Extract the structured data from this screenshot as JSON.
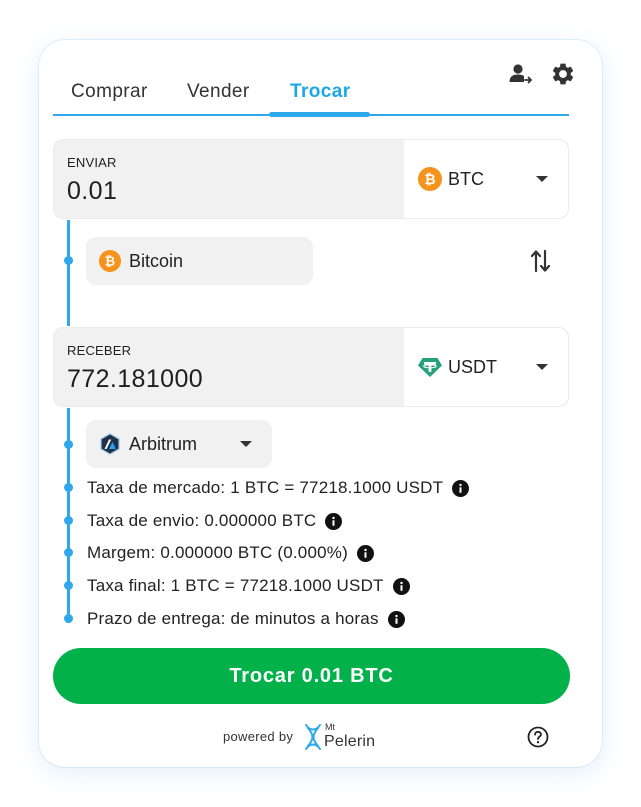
{
  "header": {
    "account_icon": "person-arrow-icon",
    "settings_icon": "gear-icon"
  },
  "tabs": [
    {
      "label": "Comprar",
      "active": false
    },
    {
      "label": "Vender",
      "active": false
    },
    {
      "label": "Trocar",
      "active": true
    }
  ],
  "send": {
    "label": "ENVIAR",
    "amount": "0.01",
    "currency": "BTC",
    "currency_icon": "bitcoin-icon",
    "network": "Bitcoin",
    "network_icon": "bitcoin-icon"
  },
  "receive": {
    "label": "RECEBER",
    "amount": "772.181000",
    "currency": "USDT",
    "currency_icon": "tether-icon",
    "network": "Arbitrum",
    "network_icon": "arbitrum-icon"
  },
  "rates": [
    {
      "text": "Taxa de mercado: 1 BTC = 77218.1000 USDT"
    },
    {
      "text": "Taxa de envio: 0.000000 BTC"
    },
    {
      "text": "Margem: 0.000000 BTC (0.000%)"
    },
    {
      "text": "Taxa final: 1 BTC = 77218.1000 USDT"
    },
    {
      "text": "Prazo de entrega: de minutos a horas"
    }
  ],
  "action_button": "Trocar 0.01 BTC",
  "footer": {
    "powered_by": "powered by",
    "brand_small": "Mt",
    "brand": "Pelerin",
    "help_icon": "question-circle-icon"
  },
  "colors": {
    "accent": "#2ea8ea",
    "button": "#03b14b",
    "bitcoin": "#f7931a",
    "tether": "#26a17b"
  }
}
